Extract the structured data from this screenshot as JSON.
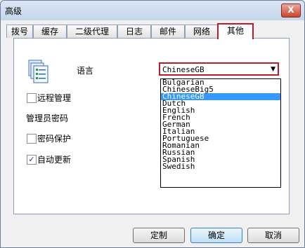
{
  "window": {
    "title": "高级",
    "close_label": "X"
  },
  "tabs": [
    "拨号",
    "缓存",
    "二级代理",
    "日志",
    "邮件",
    "网络",
    "其他"
  ],
  "settings": {
    "language_label": "语言",
    "language_value": "ChineseGB",
    "remote_label": "远程管理",
    "remote_checked": false,
    "admin_password_label": "管理员密码",
    "password_protect_label": "密码保护",
    "password_protect_checked": false,
    "auto_update_label": "自动更新",
    "auto_update_checked": true
  },
  "language_options": [
    "Bulgarian",
    "ChineseBig5",
    "ChineseGB",
    "Dutch",
    "English",
    "French",
    "German",
    "Italian",
    "Portuguese",
    "Romanian",
    "Russian",
    "Spanish",
    "Swedish"
  ],
  "selected_option": "ChineseGB",
  "buttons": {
    "custom": "定制",
    "ok": "确定",
    "cancel": "取消"
  },
  "colors": {
    "highlight": "#c0182d",
    "selection": "#3399ff"
  }
}
